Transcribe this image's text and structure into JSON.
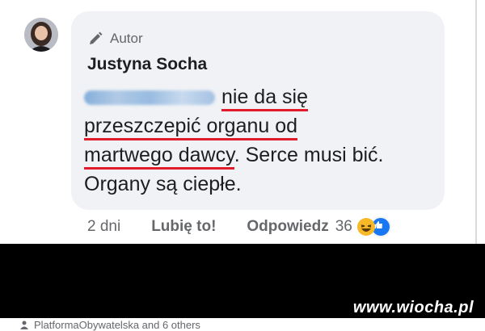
{
  "comment": {
    "author_badge": "Autor",
    "author_name": "Justyna Socha",
    "lines": [
      "nie da się",
      "przeszczepić organu od",
      "martwego dawcy",
      ". Serce musi bić.",
      "Organy są ciepłe."
    ],
    "time": "2 dni",
    "like_label": "Lubię to!",
    "reply_label": "Odpowiedz",
    "reaction_count": "36",
    "reactions": [
      "haha-icon",
      "like-icon"
    ]
  },
  "watermark": "www.wiocha.pl",
  "footer": {
    "text": "PlatformaObywatelska and 6 others"
  },
  "colors": {
    "bubble": "#f0f2f5",
    "underline": "#e21b2c",
    "like_blue": "#1877f2",
    "haha_yellow": "#f7b928"
  }
}
